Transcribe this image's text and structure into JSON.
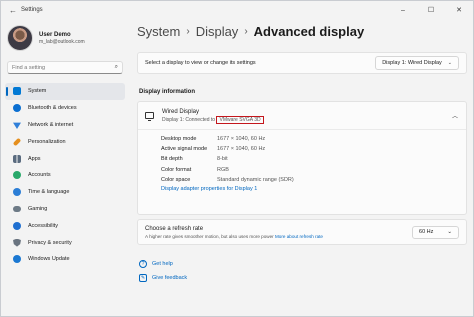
{
  "window": {
    "title": "Settings",
    "controls": [
      "–",
      "☐",
      "✕"
    ]
  },
  "profile": {
    "name": "User Demo",
    "email": "m_lab@outlook.com"
  },
  "search": {
    "placeholder": "Find a setting"
  },
  "sidebar": {
    "items": [
      {
        "label": "System",
        "icon": "system-icon",
        "color": "#0078d4",
        "active": true
      },
      {
        "label": "Bluetooth & devices",
        "icon": "bluetooth-icon",
        "color": "#0b6fd1"
      },
      {
        "label": "Network & internet",
        "icon": "network-icon",
        "color": "#2f7fd9"
      },
      {
        "label": "Personalization",
        "icon": "brush-icon",
        "color": "#e58f1e"
      },
      {
        "label": "Apps",
        "icon": "apps-icon",
        "color": "#5a6b7f"
      },
      {
        "label": "Accounts",
        "icon": "accounts-icon",
        "color": "#2aa96b"
      },
      {
        "label": "Time & language",
        "icon": "clock-icon",
        "color": "#2c7ed6"
      },
      {
        "label": "Gaming",
        "icon": "gaming-icon",
        "color": "#6d7a86"
      },
      {
        "label": "Accessibility",
        "icon": "accessibility-icon",
        "color": "#1f6fd0"
      },
      {
        "label": "Privacy & security",
        "icon": "shield-icon",
        "color": "#6a7480"
      },
      {
        "label": "Windows Update",
        "icon": "update-icon",
        "color": "#1b78d2"
      }
    ]
  },
  "breadcrumb": {
    "part1": "System",
    "part2": "Display",
    "current": "Advanced display"
  },
  "select_display": {
    "label": "Select a display to view or change its settings",
    "value": "Display 1: Wired Display"
  },
  "display_info": {
    "section_title": "Display information",
    "name": "Wired Display",
    "sub_prefix": "Display 1: Connected to",
    "adapter": "VMware SVGA 3D",
    "rows": [
      {
        "k": "Desktop mode",
        "v": "1677 × 1040, 60 Hz"
      },
      {
        "k": "Active signal mode",
        "v": "1677 × 1040, 60 Hz"
      },
      {
        "k": "Bit depth",
        "v": "8-bit"
      },
      {
        "k": "Color format",
        "v": "RGB"
      },
      {
        "k": "Color space",
        "v": "Standard dynamic range (SDR)"
      }
    ],
    "adapter_link": "Display adapter properties for Display 1"
  },
  "refresh": {
    "title": "Choose a refresh rate",
    "desc": "A higher rate gives smoother motion, but also uses more power",
    "link": "More about refresh rate",
    "value": "60 Hz"
  },
  "help": {
    "get_help": "Get help",
    "feedback": "Give feedback"
  }
}
